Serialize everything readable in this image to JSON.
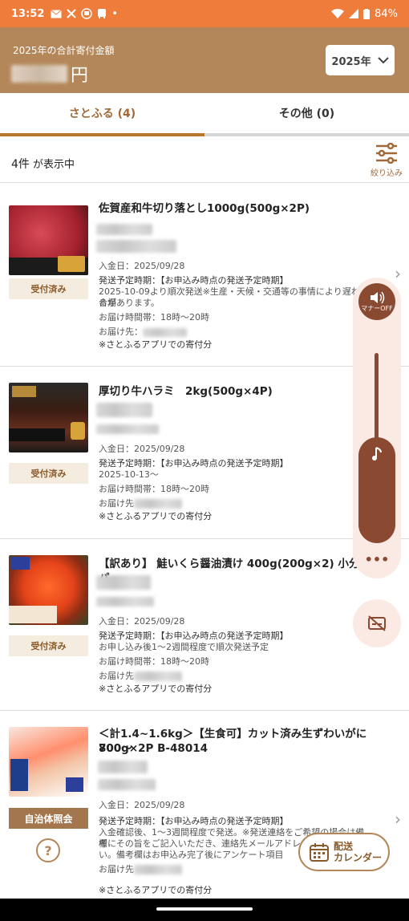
{
  "status": {
    "time": "13:52",
    "battery": "84%"
  },
  "header": {
    "label": "2025年の合計寄付金額",
    "currency": "円",
    "year_button": "2025年"
  },
  "tabs": [
    {
      "label": "さとふる (4)"
    },
    {
      "label": "その他 (0)"
    }
  ],
  "count": {
    "number": "4件",
    "suffix": " が表示中"
  },
  "filter_label": "絞り込み",
  "items": [
    {
      "title": "佐賀産和牛切り落とし1000g(500g×2P)",
      "deposit": "入金日：2025/09/28",
      "ship1": "発送予定時期：【お申込み時点の発送予定時期】",
      "ship2": "2025-10-09より順次発送※生産・天候・交通等の事情により遅れる場",
      "ship3": "合があります。",
      "time": "お届け時間帯：18時～20時",
      "dest": "お届け先：",
      "note": "※さとふるアプリでの寄付分",
      "badge": "受付済み"
    },
    {
      "title": "厚切り牛ハラミ　2kg(500g×4P)",
      "deposit": "入金日：2025/09/28",
      "ship1": "発送予定時期：【お申込み時点の発送予定時期】",
      "ship2": "2025-10-13～",
      "time": "お届け時間帯：18時～20時",
      "dest": "お届け先",
      "note": "※さとふるアプリでの寄付分",
      "badge": "受付済み"
    },
    {
      "title": "【訳あり】 鮭いくら醤油漬け 400g(200g×2) 小分けパ",
      "deposit": "入金日：2025/09/28",
      "ship1": "発送予定時期：【お申込み時点の発送予定時期】",
      "ship2": "お申し込み後1～2週間程度で順次発送予定",
      "time": "お届け時間帯：18時～20時",
      "dest": "お届け先",
      "note": "※さとふるアプリでの寄付分",
      "badge": "受付済み"
    },
    {
      "title": "＜計1.4~1.6kg＞【生食可】カット済み生ずわいがに700～",
      "title2": "800g×2P B-48014",
      "deposit": "入金日：2025/09/28",
      "ship1": "発送予定時期：【お申込み時点の発送予定時期】",
      "ship2": "入金確認後、1～3週間程度で発送。※発送連絡をご希望の場合は備考",
      "ship3": "欄にその旨をご記入いただき、連絡先メールアドレ",
      "ship4": "い。備考欄はお申込み完了後にアンケート項目",
      "dest": "お届け先",
      "note": "※さとふるアプリでの寄付分",
      "badge": "自治体照会",
      "help": "?"
    }
  ],
  "volume": {
    "manner": "マナーOFF"
  },
  "calendar": {
    "line1": "配送",
    "line2": "カレンダー"
  },
  "colors": {
    "status": "#ee7d3c",
    "header": "#b4875a",
    "accent": "#a0693a"
  }
}
